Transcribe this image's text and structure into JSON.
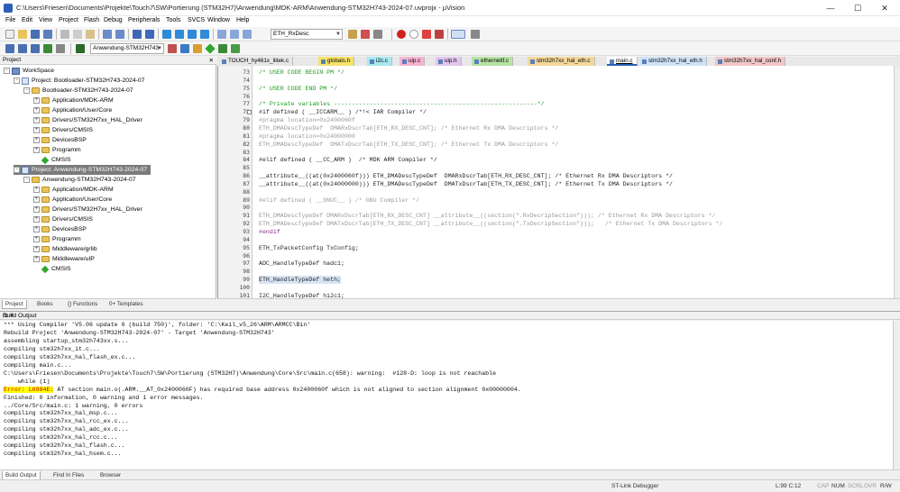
{
  "window": {
    "title": "C:\\Users\\Friesen\\Documents\\Projekte\\Touch7\\SW\\Portierung (STM32H7)\\Anwendung\\MDK-ARM\\Anwendung-STM32H743-2024-07.uvprojx - µVision",
    "min": "—",
    "max": "☐",
    "close": "✕"
  },
  "menu": [
    "File",
    "Edit",
    "View",
    "Project",
    "Flash",
    "Debug",
    "Peripherals",
    "Tools",
    "SVCS",
    "Window",
    "Help"
  ],
  "toolbar": {
    "find_combo": "ETH_RxDesc",
    "target_combo": "Anwendung-STM32H743"
  },
  "project_pane": {
    "title": "Project",
    "close": "✕",
    "tree": [
      {
        "label": "WorkSpace",
        "icon": "workspace-icon",
        "indent": 0,
        "expander": "-"
      },
      {
        "label": "Project: Bootloader-STM32H743-2024-07",
        "icon": "project-icon",
        "indent": 1,
        "expander": "-"
      },
      {
        "label": "Bootloader-STM32H743-2024-07",
        "icon": "folder-icon",
        "indent": 2,
        "expander": "-"
      },
      {
        "label": "Application/MDK-ARM",
        "icon": "folder-icon",
        "indent": 3,
        "expander": "+"
      },
      {
        "label": "Application/User/Core",
        "icon": "folder-icon",
        "indent": 3,
        "expander": "+"
      },
      {
        "label": "Drivers/STM32H7xx_HAL_Driver",
        "icon": "folder-icon",
        "indent": 3,
        "expander": "+"
      },
      {
        "label": "Drivers/CMSIS",
        "icon": "folder-icon",
        "indent": 3,
        "expander": "+"
      },
      {
        "label": "DevicesBSP",
        "icon": "folder-icon",
        "indent": 3,
        "expander": "+"
      },
      {
        "label": "Programm",
        "icon": "folder-icon",
        "indent": 3,
        "expander": "+"
      },
      {
        "label": "CMSIS",
        "icon": "gem-icon",
        "indent": 3,
        "expander": ""
      },
      {
        "label": "Project: Anwendung-STM32H743-2024-07",
        "icon": "project-icon",
        "indent": 1,
        "expander": "-",
        "selected": true
      },
      {
        "label": "Anwendung-STM32H743-2024-07",
        "icon": "folder-icon",
        "indent": 2,
        "expander": "-"
      },
      {
        "label": "Application/MDK-ARM",
        "icon": "folder-icon",
        "indent": 3,
        "expander": "+"
      },
      {
        "label": "Application/User/Core",
        "icon": "folder-icon",
        "indent": 3,
        "expander": "+"
      },
      {
        "label": "Drivers/STM32H7xx_HAL_Driver",
        "icon": "folder-icon",
        "indent": 3,
        "expander": "+"
      },
      {
        "label": "Drivers/CMSIS",
        "icon": "folder-icon",
        "indent": 3,
        "expander": "+"
      },
      {
        "label": "DevicesBSP",
        "icon": "folder-icon",
        "indent": 3,
        "expander": "+"
      },
      {
        "label": "Programm",
        "icon": "folder-icon",
        "indent": 3,
        "expander": "+"
      },
      {
        "label": "Middleware/grlib",
        "icon": "folder-icon",
        "indent": 3,
        "expander": "+"
      },
      {
        "label": "Middleware/uIP",
        "icon": "folder-icon",
        "indent": 3,
        "expander": "+"
      },
      {
        "label": "CMSIS",
        "icon": "gem-icon",
        "indent": 3,
        "expander": ""
      }
    ],
    "tabs": [
      "Project",
      "Books",
      "{} Functions",
      "0+ Templates"
    ]
  },
  "editor": {
    "tabs": [
      {
        "label": "TOUCH_hy461x_ilitek.c",
        "color": "#e6e6e6"
      },
      {
        "label": "globals.h",
        "color": "#f5e36a"
      },
      {
        "label": "i2c.c",
        "color": "#a8e8f0"
      },
      {
        "label": "uip.c",
        "color": "#f7b3d0"
      },
      {
        "label": "uip.h",
        "color": "#e2c6ee"
      },
      {
        "label": "ethernetif.c",
        "color": "#b7e3a3"
      },
      {
        "label": "stm32h7xx_hal_eth.c",
        "color": "#f3d79a"
      },
      {
        "label": "main.c",
        "color": "#ffffff",
        "active": true
      },
      {
        "label": "stm32h7xx_hal_eth.h",
        "color": "#cfe3f7"
      },
      {
        "label": "stm32h7xx_hal_conf.h",
        "color": "#f1c6c6"
      }
    ],
    "lines": [
      {
        "n": "73",
        "t": "/* USER CODE BEGIN PM */",
        "k": "cmt"
      },
      {
        "n": "74",
        "t": "",
        "k": ""
      },
      {
        "n": "75",
        "t": "/* USER CODE END PM */",
        "k": "cmt"
      },
      {
        "n": "76",
        "t": "",
        "k": ""
      },
      {
        "n": "77",
        "t": "/* Private variables ---------------------------------------------------------*/",
        "k": "cmt"
      },
      {
        "n": "78",
        "t": "#if defined ( __ICCARM__ ) /*!< IAR Compiler */",
        "k": "",
        "fold": true
      },
      {
        "n": "79",
        "t": "#pragma location=0x2400060f",
        "k": "dim"
      },
      {
        "n": "80",
        "t": "ETH_DMADescTypeDef  DMARxDscrTab[ETH_RX_DESC_CNT]; /* Ethernet Rx DMA Descriptors */",
        "k": "dim"
      },
      {
        "n": "81",
        "t": "#pragma location=0x24000000",
        "k": "dim"
      },
      {
        "n": "82",
        "t": "ETH_DMADescTypeDef  DMATxDscrTab[ETH_TX_DESC_CNT]; /* Ethernet Tx DMA Descriptors */",
        "k": "dim"
      },
      {
        "n": "83",
        "t": "",
        "k": ""
      },
      {
        "n": "84",
        "t": "#elif defined ( __CC_ARM )  /* MDK ARM Compiler */",
        "k": ""
      },
      {
        "n": "85",
        "t": "",
        "k": ""
      },
      {
        "n": "86",
        "t": "__attribute__((at(0x2400060f))) ETH_DMADescTypeDef  DMARxDscrTab[ETH_RX_DESC_CNT]; /* Ethernet Rx DMA Descriptors */",
        "k": ""
      },
      {
        "n": "87",
        "t": "__attribute__((at(0x24000000))) ETH_DMADescTypeDef  DMATxDscrTab[ETH_TX_DESC_CNT]; /* Ethernet Tx DMA Descriptors */",
        "k": ""
      },
      {
        "n": "88",
        "t": "",
        "k": ""
      },
      {
        "n": "89",
        "t": "#elif defined ( __GNUC__ ) /* GNU Compiler */",
        "k": "dim"
      },
      {
        "n": "90",
        "t": "",
        "k": ""
      },
      {
        "n": "91",
        "t": "ETH_DMADescTypeDef DMARxDscrTab[ETH_RX_DESC_CNT] __attribute__((section(\".RxDecripSection\"))); /* Ethernet Rx DMA Descriptors */",
        "k": "dim"
      },
      {
        "n": "92",
        "t": "ETH_DMADescTypeDef DMATxDscrTab[ETH_TX_DESC_CNT] __attribute__((section(\".TxDecripSection\")));   /* Ethernet Tx DMA Descriptors */",
        "k": "dim"
      },
      {
        "n": "93",
        "t": "#endif",
        "k": "pp"
      },
      {
        "n": "94",
        "t": "",
        "k": ""
      },
      {
        "n": "95",
        "t": "ETH_TxPacketConfig TxConfig;",
        "k": ""
      },
      {
        "n": "96",
        "t": "",
        "k": ""
      },
      {
        "n": "97",
        "t": "ADC_HandleTypeDef hadc1;",
        "k": ""
      },
      {
        "n": "98",
        "t": "",
        "k": ""
      },
      {
        "n": "99",
        "t": "ETH_HandleTypeDef heth;",
        "k": "",
        "hl": true
      },
      {
        "n": "100",
        "t": "",
        "k": ""
      },
      {
        "n": "101",
        "t": "I2C_HandleTypeDef hi2c1;",
        "k": ""
      }
    ]
  },
  "build": {
    "title": "Build Output",
    "controls": "⊡ ✕",
    "lines": [
      "*** Using Compiler 'V5.06 update 6 (build 750)', folder: 'C:\\Keil_v5_26\\ARM\\ARMCC\\Bin'",
      "Rebuild Project 'Anwendung-STM32H743-2024-07' - Target 'Anwendung-STM32H743'",
      "assembling startup_stm32h743xx.s...",
      "compiling stm32h7xx_it.c...",
      "compiling stm32h7xx_hal_flash_ex.c...",
      "compiling main.c...",
      "C:\\Users\\Friesen\\Documents\\Projekte\\Touch7\\SW\\Portierung (STM32H7)\\Anwendung\\Core\\Src\\main.c(658): warning:  #128-D: loop is not reachable",
      "    while (1)",
      "ERRORLINE",
      "Finished: 0 information, 0 warning and 1 error messages.",
      "../Core/Src/main.c: 1 warning, 0 errors",
      "compiling stm32h7xx_hal_msp.c...",
      "compiling stm32h7xx_hal_rcc_ex.c...",
      "compiling stm32h7xx_hal_adc_ex.c...",
      "compiling stm32h7xx_hal_rcc.c...",
      "compiling stm32h7xx_hal_flash.c...",
      "compiling stm32h7xx_hal_hsem.c..."
    ],
    "error_tag": "Error: L6984E:",
    "error_msg": " AT section main.o(.ARM.__AT_0x2400060F) has required base address 0x2400060f which is not aligned to section alignment 0x00000004.",
    "tabs": [
      "Build Output",
      "Find In Files",
      "Browser"
    ]
  },
  "status": {
    "debugger": "ST-Link Debugger",
    "position": "L:99 C:12",
    "cap": "CAP",
    "num": "NUM",
    "scrl": "SCRL",
    "ovr": "OVR",
    "rw": "R/W"
  }
}
